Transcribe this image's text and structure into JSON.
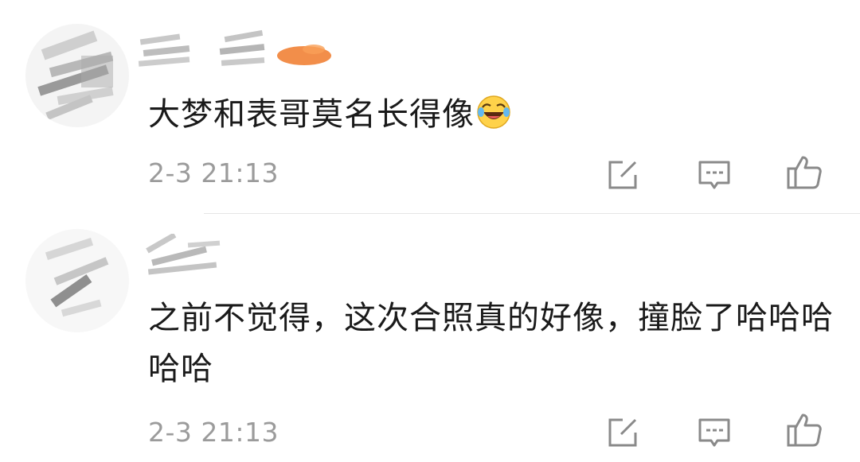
{
  "comments": [
    {
      "text": "大梦和表哥莫名长得像",
      "emoji_icon": "laughing-crying-emoji-icon",
      "timestamp": "2-3 21:13"
    },
    {
      "text": "之前不觉得，这次合照真的好像，撞脸了哈哈哈哈哈",
      "timestamp": "2-3 21:13"
    }
  ],
  "icons": {
    "repost": "share-external-icon",
    "reply": "comment-icon",
    "like": "thumbs-up-icon"
  },
  "colors": {
    "text": "#1a1a1a",
    "meta": "#9b9b9b",
    "icon": "#8a8a8a",
    "divider": "#e6e6e6",
    "vip_badge": "#f07a2a"
  }
}
